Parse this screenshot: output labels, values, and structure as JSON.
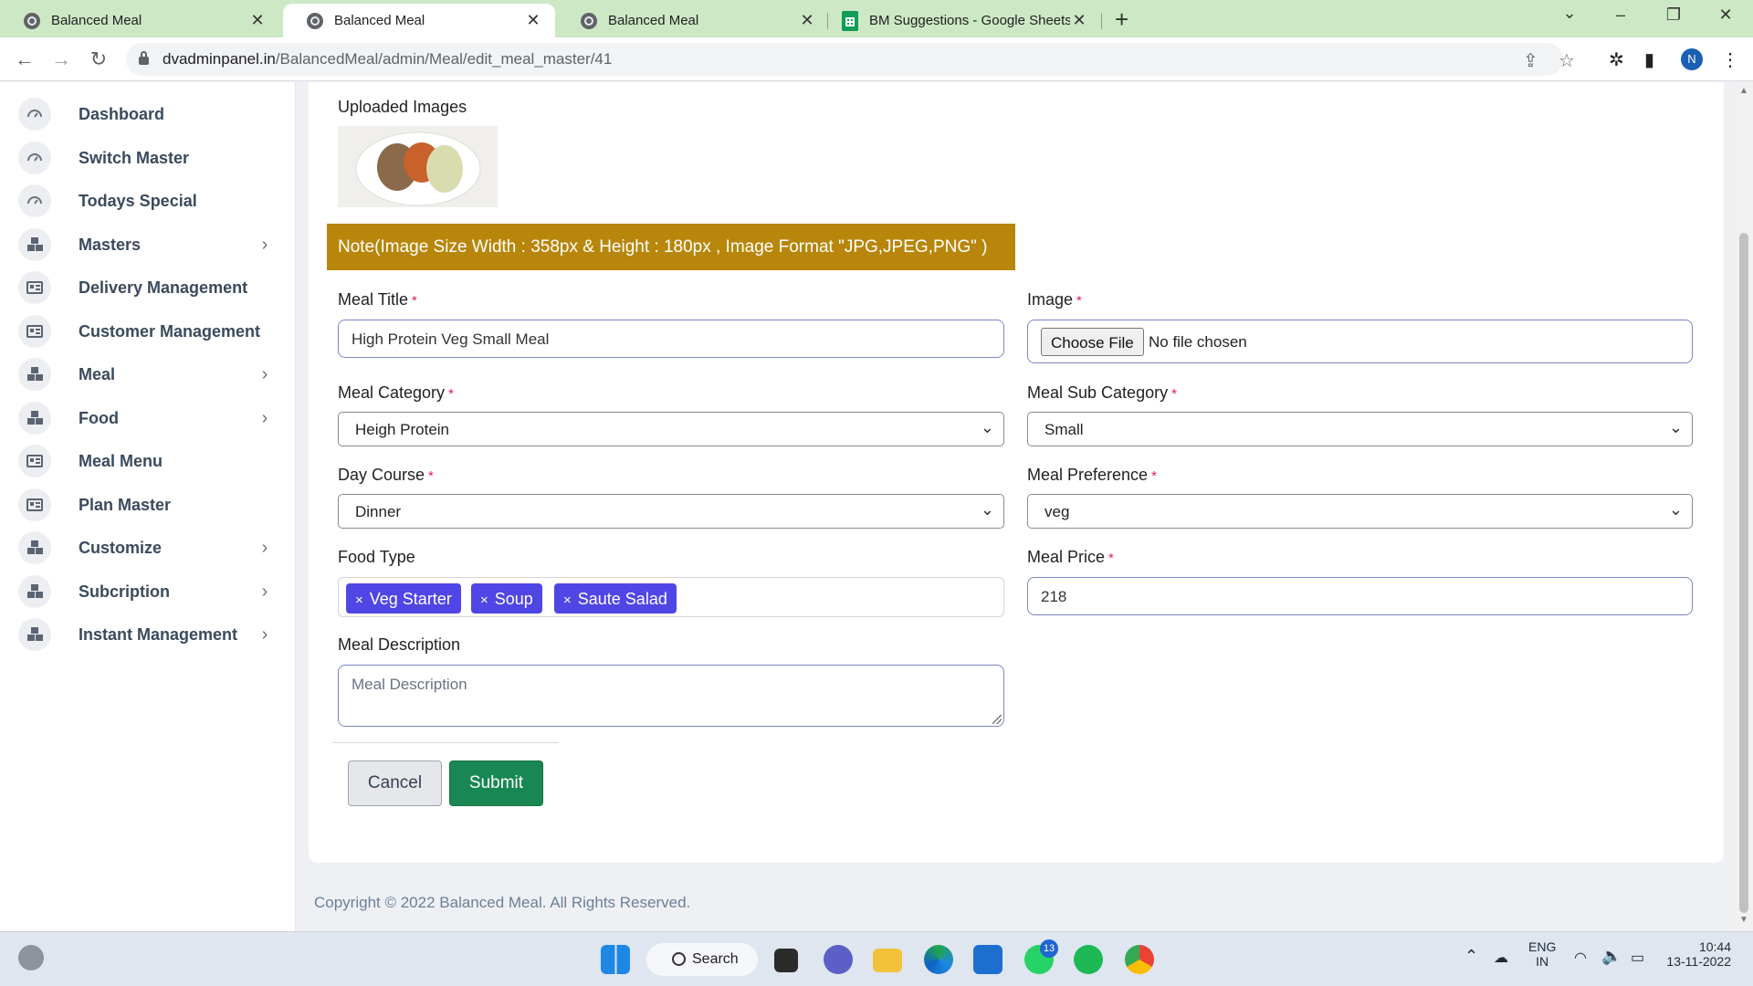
{
  "browser": {
    "tabs": [
      {
        "title": "Balanced Meal",
        "close": "✕"
      },
      {
        "title": "Balanced Meal",
        "close": "✕"
      },
      {
        "title": "Balanced Meal",
        "close": "✕"
      },
      {
        "title": "BM Suggestions - Google Sheets",
        "close": "✕"
      }
    ],
    "active_tab_index": 1,
    "url_domain": "dvadminpanel.in",
    "url_path": "/BalancedMeal/admin/Meal/edit_meal_master/41",
    "profile_initial": "N"
  },
  "sidebar": {
    "items": [
      {
        "label": "Dashboard",
        "icon": "gauge-icon",
        "has_submenu": false
      },
      {
        "label": "Switch Master",
        "icon": "gauge-icon",
        "has_submenu": false
      },
      {
        "label": "Todays Special",
        "icon": "gauge-icon",
        "has_submenu": false
      },
      {
        "label": "Masters",
        "icon": "cubes-icon",
        "has_submenu": true
      },
      {
        "label": "Delivery Management",
        "icon": "id-card-icon",
        "has_submenu": false
      },
      {
        "label": "Customer Management",
        "icon": "id-card-icon",
        "has_submenu": false
      },
      {
        "label": "Meal",
        "icon": "cubes-icon",
        "has_submenu": true
      },
      {
        "label": "Food",
        "icon": "cubes-icon",
        "has_submenu": true
      },
      {
        "label": "Meal Menu",
        "icon": "id-card-icon",
        "has_submenu": false
      },
      {
        "label": "Plan Master",
        "icon": "id-card-icon",
        "has_submenu": false
      },
      {
        "label": "Customize",
        "icon": "cubes-icon",
        "has_submenu": true
      },
      {
        "label": "Subcription",
        "icon": "cubes-icon",
        "has_submenu": true
      },
      {
        "label": "Instant Management",
        "icon": "cubes-icon",
        "has_submenu": true
      }
    ],
    "chevron": "›"
  },
  "form": {
    "uploaded_images_label": "Uploaded Images",
    "note": "Note(Image Size Width : 358px & Height : 180px , Image Format \"JPG,JPEG,PNG\" )",
    "required_mark": "*",
    "meal_title": {
      "label": "Meal Title",
      "value": "High Protein Veg Small Meal"
    },
    "image": {
      "label": "Image",
      "button": "Choose File",
      "status": "No file chosen"
    },
    "meal_category": {
      "label": "Meal Category",
      "value": "Heigh Protein"
    },
    "meal_sub_category": {
      "label": "Meal Sub Category",
      "value": "Small"
    },
    "day_course": {
      "label": "Day Course",
      "value": "Dinner"
    },
    "meal_preference": {
      "label": "Meal Preference",
      "value": "veg"
    },
    "food_type": {
      "label": "Food Type",
      "tags": [
        "Veg Starter",
        "Soup",
        "Saute Salad"
      ],
      "remove_mark": "×"
    },
    "meal_price": {
      "label": "Meal Price",
      "value": "218"
    },
    "meal_description": {
      "label": "Meal Description",
      "placeholder": "Meal Description"
    },
    "cancel_label": "Cancel",
    "submit_label": "Submit"
  },
  "footer": {
    "copyright": "Copyright © 2022 Balanced Meal. All Rights Reserved."
  },
  "taskbar": {
    "search_label": "Search",
    "whatsapp_badge": "13",
    "language_line1": "ENG",
    "language_line2": "IN",
    "time": "10:44",
    "date": "13-11-2022"
  },
  "colors": {
    "note_bg": "#b8860b",
    "tag_bg": "#4f46e5",
    "submit_bg": "#198754",
    "tabstrip_bg": "#cde8c5"
  }
}
